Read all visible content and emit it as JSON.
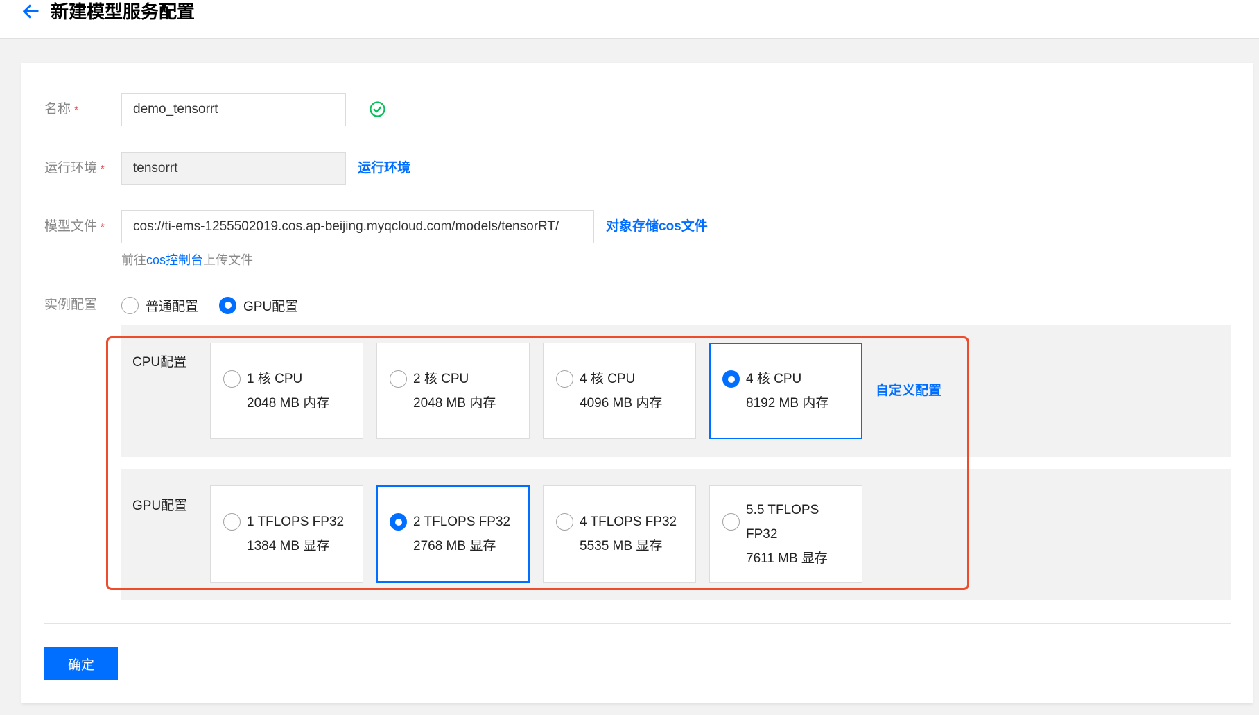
{
  "header": {
    "back_icon": "arrow-left-icon",
    "title": "新建模型服务配置"
  },
  "form": {
    "name": {
      "label": "名称",
      "required_mark": "*",
      "value": "demo_tensorrt",
      "status_icon": "check-circle-icon"
    },
    "runtime": {
      "label": "运行环境",
      "required_mark": "*",
      "value": "tensorrt",
      "link": "运行环境"
    },
    "model_file": {
      "label": "模型文件",
      "required_mark": "*",
      "value": "cos://ti-ems-1255502019.cos.ap-beijing.myqcloud.com/models/tensorRT/",
      "link": "对象存储cos文件",
      "hint": {
        "prefix": "前往",
        "link": "cos控制台",
        "suffix": "上传文件"
      }
    },
    "instance": {
      "label": "实例配置",
      "options": [
        {
          "label": "普通配置",
          "selected": false
        },
        {
          "label": "GPU配置",
          "selected": true
        }
      ]
    }
  },
  "cpu_config": {
    "label": "CPU配置",
    "options": [
      {
        "spec": "1 核 CPU",
        "memory": "2048 MB 内存",
        "selected": false
      },
      {
        "spec": "2 核 CPU",
        "memory": "2048 MB 内存",
        "selected": false
      },
      {
        "spec": "4 核 CPU",
        "memory": "4096 MB 内存",
        "selected": false
      },
      {
        "spec": "4 核 CPU",
        "memory": "8192 MB 内存",
        "selected": true
      }
    ],
    "custom_link": "自定义配置"
  },
  "gpu_config": {
    "label": "GPU配置",
    "options": [
      {
        "spec": "1 TFLOPS FP32",
        "memory": "1384 MB 显存",
        "selected": false
      },
      {
        "spec": "2 TFLOPS FP32",
        "memory": "2768 MB 显存",
        "selected": true
      },
      {
        "spec": "4 TFLOPS FP32",
        "memory": "5535 MB 显存",
        "selected": false
      },
      {
        "spec": "5.5 TFLOPS FP32",
        "memory": "7611 MB 显存",
        "selected": false
      }
    ]
  },
  "actions": {
    "confirm_label": "确定"
  },
  "colors": {
    "primary": "#006eff",
    "success": "#0abf5b",
    "required": "#e54545",
    "highlight": "#ee4d2d",
    "panel_bg": "#f2f2f2"
  }
}
